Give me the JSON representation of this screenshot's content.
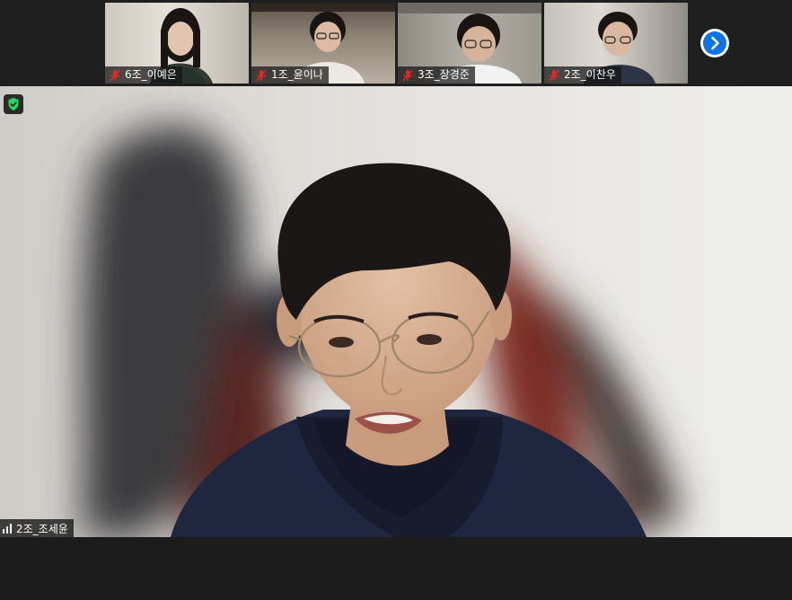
{
  "participants": [
    {
      "name": "6조_이예은",
      "muted": true
    },
    {
      "name": "1조_윤이나",
      "muted": true
    },
    {
      "name": "3조_장경준",
      "muted": true
    },
    {
      "name": "2조_이찬우",
      "muted": true
    }
  ],
  "active_speaker": {
    "name": "2조_조세윤",
    "signal_icon": "signal-bars-icon"
  },
  "icons": {
    "next_page": "chevron-right-icon",
    "encryption": "shield-check-icon",
    "mute": "mic-off-icon"
  },
  "colors": {
    "accent": "#0e72ed",
    "mute": "#e02828",
    "shield": "#23d959"
  }
}
